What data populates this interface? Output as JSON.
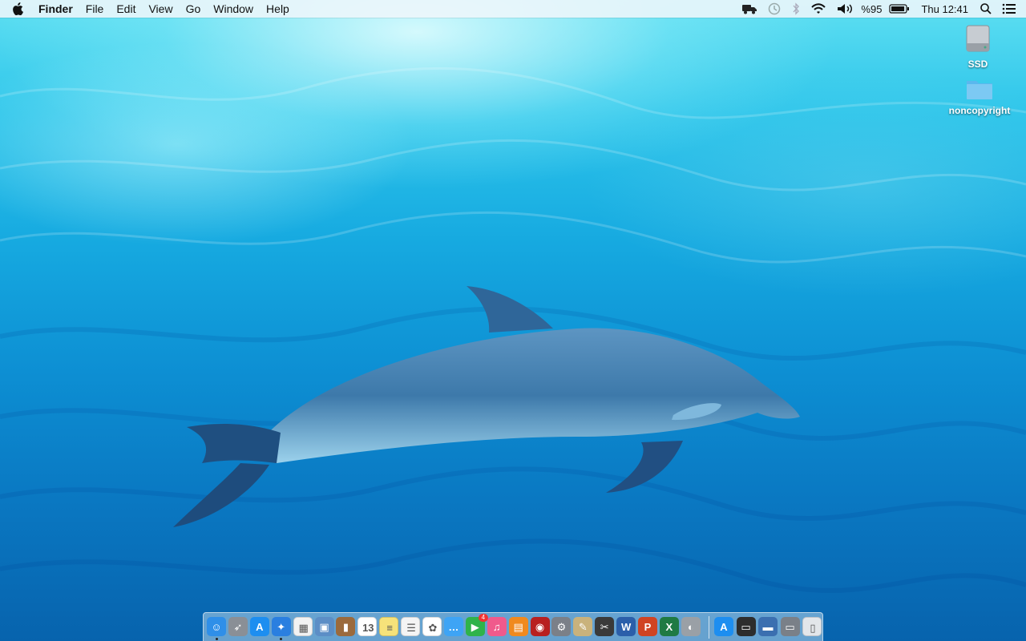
{
  "menubar": {
    "apple_icon": "apple-logo-icon",
    "app_name": "Finder",
    "menus": [
      "File",
      "Edit",
      "View",
      "Go",
      "Window",
      "Help"
    ],
    "status": {
      "battery_percent_text": "%95",
      "battery_level": 0.95,
      "clock": "Thu 12:41",
      "icons": [
        "truck-icon",
        "time-machine-icon",
        "bluetooth-icon",
        "wifi-icon",
        "volume-icon",
        "battery-icon",
        "spotlight-search-icon",
        "notification-center-icon"
      ]
    }
  },
  "desktop": {
    "icons": [
      {
        "label": "SSD",
        "icon": "hard-drive-icon"
      },
      {
        "label": "noncopyright",
        "icon": "folder-icon"
      }
    ]
  },
  "dock": {
    "apps": [
      {
        "name": "finder",
        "color": "#2f8fe8",
        "glyph": "☺",
        "running": true
      },
      {
        "name": "launchpad",
        "color": "#8a8f96",
        "glyph": "➶",
        "running": false
      },
      {
        "name": "app-store",
        "color": "#1d8ef0",
        "glyph": "A",
        "running": false
      },
      {
        "name": "safari",
        "color": "#2a7fe0",
        "glyph": "✦",
        "running": true
      },
      {
        "name": "calculator",
        "color": "#f2f2f2",
        "glyph": "▦",
        "running": false
      },
      {
        "name": "preview",
        "color": "#5c8ec6",
        "glyph": "▣",
        "running": false
      },
      {
        "name": "contacts",
        "color": "#9b6a3c",
        "glyph": "▮",
        "running": false
      },
      {
        "name": "calendar",
        "color": "#ffffff",
        "glyph": "13",
        "running": false
      },
      {
        "name": "notes",
        "color": "#f6e27a",
        "glyph": "≡",
        "running": false
      },
      {
        "name": "reminders",
        "color": "#f4f4f4",
        "glyph": "☰",
        "running": false
      },
      {
        "name": "photos",
        "color": "#ffffff",
        "glyph": "✿",
        "running": false
      },
      {
        "name": "messages",
        "color": "#3ea4f5",
        "glyph": "…",
        "running": false
      },
      {
        "name": "facetime",
        "color": "#2fb34a",
        "glyph": "▶",
        "running": false,
        "badge": "4"
      },
      {
        "name": "itunes",
        "color": "#f05a8c",
        "glyph": "♫",
        "running": false
      },
      {
        "name": "ibooks",
        "color": "#f08a1e",
        "glyph": "▤",
        "running": false
      },
      {
        "name": "photo-booth",
        "color": "#b82020",
        "glyph": "◉",
        "running": false
      },
      {
        "name": "system-preferences",
        "color": "#7b8088",
        "glyph": "⚙",
        "running": false
      },
      {
        "name": "textedit",
        "color": "#c9b27c",
        "glyph": "✎",
        "running": false
      },
      {
        "name": "final-cut-pro",
        "color": "#3a3a3a",
        "glyph": "✂",
        "running": false
      },
      {
        "name": "word",
        "color": "#2b5faa",
        "glyph": "W",
        "running": false
      },
      {
        "name": "powerpoint",
        "color": "#d04423",
        "glyph": "P",
        "running": false
      },
      {
        "name": "excel",
        "color": "#1f7a43",
        "glyph": "X",
        "running": false
      },
      {
        "name": "disk-utility",
        "color": "#9aa0a6",
        "glyph": "◐",
        "running": false
      },
      {
        "name": "app-store-downloads",
        "color": "#1d8ef0",
        "glyph": "A",
        "running": false
      },
      {
        "name": "terminal-folder",
        "color": "#2d2d2d",
        "glyph": "▭",
        "running": false
      },
      {
        "name": "cards-folder",
        "color": "#3b6fb0",
        "glyph": "▬",
        "running": false
      },
      {
        "name": "scanner-folder",
        "color": "#7a8088",
        "glyph": "▭",
        "running": false
      },
      {
        "name": "trash",
        "color": "#e3e6ea",
        "glyph": "▯",
        "running": false
      }
    ]
  }
}
